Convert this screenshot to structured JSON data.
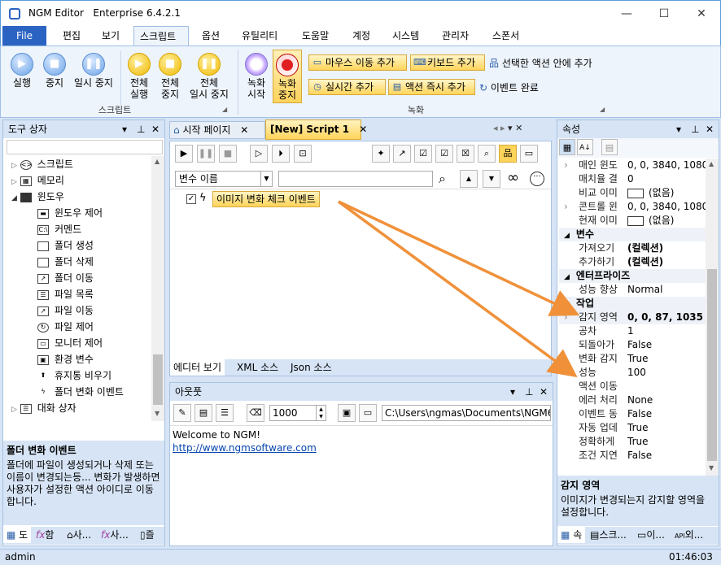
{
  "window": {
    "title": "NGM Editor   Enterprise 6.4.2.1",
    "minimize": "—",
    "maximize": "☐",
    "close": "✕"
  },
  "menu": {
    "file": "File",
    "items": [
      "편집",
      "보기",
      "스크립트",
      "옵션",
      "유틸리티",
      "도움말",
      "계정",
      "시스템",
      "관리자",
      "스폰서"
    ]
  },
  "ribbon": {
    "script_group": "스크립트",
    "record_group": "녹화",
    "run": "실행",
    "stop": "중지",
    "pause": "일시 중지",
    "run_all_1": "전체",
    "run_all_2": "실행",
    "stop_all_1": "전체",
    "stop_all_2": "중지",
    "pause_all_1": "전체",
    "pause_all_2": "일시 중지",
    "rec_start_1": "녹화",
    "rec_start_2": "시작",
    "rec_stop_1": "녹화",
    "rec_stop_2": "중지",
    "add_mouse": "마우스 이동 추가",
    "add_keyboard": "키보드 추가",
    "add_in_selected": "선택한 액션 안에 추가",
    "add_realtime": "실시간 추가",
    "add_immediate": "액션 즉시 추가",
    "event_done": "이벤트 완료"
  },
  "toolbox": {
    "title": "도구 상자",
    "items": [
      {
        "label": "스크립트",
        "level": 0
      },
      {
        "label": "메모리",
        "level": 0
      },
      {
        "label": "윈도우",
        "level": 0
      },
      {
        "label": "윈도우 제어",
        "level": 1
      },
      {
        "label": "커멘드",
        "level": 1
      },
      {
        "label": "폴더 생성",
        "level": 1
      },
      {
        "label": "폴더 삭제",
        "level": 1
      },
      {
        "label": "폴더 이동",
        "level": 1
      },
      {
        "label": "파일 목록",
        "level": 1
      },
      {
        "label": "파일 이동",
        "level": 1
      },
      {
        "label": "파일 제어",
        "level": 1
      },
      {
        "label": "모니터 제어",
        "level": 1
      },
      {
        "label": "환경 변수",
        "level": 1
      },
      {
        "label": "휴지통 비우기",
        "level": 1
      },
      {
        "label": "폴더 변화 이벤트",
        "level": 1
      },
      {
        "label": "대화 상자",
        "level": 0
      }
    ],
    "desc_title": "폴더 변화 이벤트",
    "desc_text": "폴더에 파일이 생성되거나 삭제 또는 이름이 변경되는등... 변화가 발생하면 사용자가 설정한 액션 아이디로 이동합니다.",
    "bottom_tabs": [
      "도",
      "함",
      "사...",
      "사...",
      "즐"
    ]
  },
  "editor": {
    "tab_start": "시작 페이지",
    "tab_script": "[New] Script 1",
    "var_select": "변수 이름",
    "event_label": "이미지 변화 체크 이벤트",
    "view_tabs": [
      "에디터 보기",
      "XML 소스",
      "Json 소스"
    ]
  },
  "output": {
    "title": "아웃풋",
    "count": "1000",
    "path": "C:\\Users\\ngmas\\Documents\\NGM6\\",
    "welcome": "Welcome to NGM!",
    "link": "http://www.ngmsoftware.com"
  },
  "properties": {
    "title": "속성",
    "rows_top": [
      {
        "k": "매인 윈도",
        "v": "0, 0, 3840, 1080"
      },
      {
        "k": "매치율 결",
        "v": "0"
      },
      {
        "k": "비교 이미",
        "v": "(없음)"
      },
      {
        "k": "콘트롤 윈",
        "v": "0, 0, 3840, 1080"
      },
      {
        "k": "현재 이미",
        "v": "(없음)"
      }
    ],
    "cat_var": "변수",
    "var_rows": [
      {
        "k": "가져오기",
        "v": "(컬렉션)"
      },
      {
        "k": "추가하기",
        "v": "(컬렉션)"
      }
    ],
    "cat_ent": "엔터프라이즈",
    "ent_rows": [
      {
        "k": "성능 향상",
        "v": "Normal"
      }
    ],
    "cat_work": "작업",
    "work_rows": [
      {
        "k": "감지 영역",
        "v": "0, 0, 87, 1035"
      },
      {
        "k": "공차",
        "v": "1"
      },
      {
        "k": "되돌아가",
        "v": "False"
      },
      {
        "k": "변화 감지",
        "v": "True"
      },
      {
        "k": "성능",
        "v": "100"
      },
      {
        "k": "액션 이동",
        "v": ""
      },
      {
        "k": "에러 처리",
        "v": "None"
      },
      {
        "k": "이벤트 동",
        "v": "False"
      },
      {
        "k": "자동 업데",
        "v": "True"
      },
      {
        "k": "정확하게",
        "v": "True"
      },
      {
        "k": "조건 지연",
        "v": "False"
      }
    ],
    "desc_title": "감지 영역",
    "desc_text": "이미지가 변경되는지 감지할 영역을 설정합니다.",
    "bottom_tabs": [
      "속",
      "스크...",
      "이...",
      "외..."
    ]
  },
  "status": {
    "user": "admin",
    "time": "01:46:03"
  },
  "colors": {
    "accent": "#2b63c2",
    "arrow": "#f0913a",
    "highlight": "#ffd45a"
  }
}
